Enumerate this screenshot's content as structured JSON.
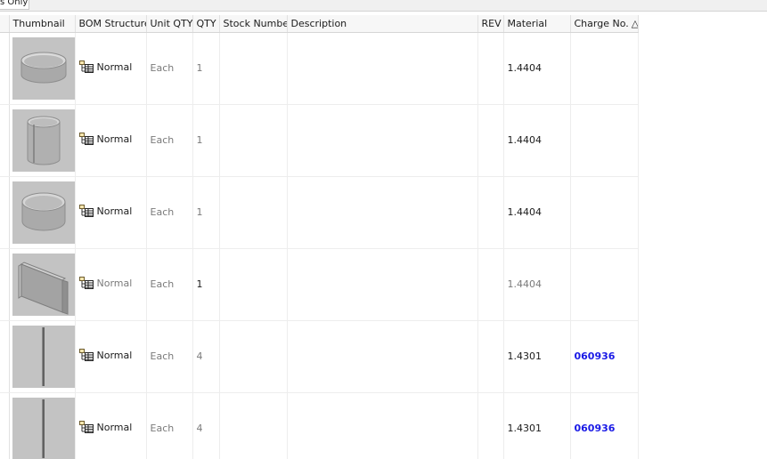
{
  "tab": {
    "label": "s Only"
  },
  "columns": {
    "thumbnail": "Thumbnail",
    "bom_structure": "BOM Structure",
    "unit_qty": "Unit QTY",
    "qty": "QTY",
    "stock_number": "Stock Number",
    "description": "Description",
    "rev": "REV",
    "material": "Material",
    "charge_no": "Charge No.",
    "charge_sort_indicator": "△"
  },
  "rows": [
    {
      "thumbnail": "ring-short-part",
      "bom": "Normal",
      "unit_qty": "Each",
      "qty": "1",
      "stock_number": "",
      "description": "",
      "rev": "",
      "material": "1.4404",
      "charge_no": ""
    },
    {
      "thumbnail": "cylinder-part",
      "bom": "Normal",
      "unit_qty": "Each",
      "qty": "1",
      "stock_number": "",
      "description": "",
      "rev": "",
      "material": "1.4404",
      "charge_no": ""
    },
    {
      "thumbnail": "ring-part",
      "bom": "Normal",
      "unit_qty": "Each",
      "qty": "1",
      "stock_number": "",
      "description": "",
      "rev": "",
      "material": "1.4404",
      "charge_no": ""
    },
    {
      "thumbnail": "bent-plate-part",
      "bom": "Normal",
      "unit_qty": "Each",
      "qty": "1",
      "stock_number": "",
      "description": "",
      "rev": "",
      "material": "1.4404",
      "charge_no": ""
    },
    {
      "thumbnail": "rod-part",
      "bom": "Normal",
      "unit_qty": "Each",
      "qty": "4",
      "stock_number": "",
      "description": "",
      "rev": "",
      "material": "1.4301",
      "charge_no": "060936"
    },
    {
      "thumbnail": "rod-part",
      "bom": "Normal",
      "unit_qty": "Each",
      "qty": "4",
      "stock_number": "",
      "description": "",
      "rev": "",
      "material": "1.4301",
      "charge_no": "060936"
    }
  ],
  "colors": {
    "charge_link": "#1a1ae6",
    "thumb_bg": "#c3c3c3",
    "muted_text": "#7a7a7a"
  }
}
